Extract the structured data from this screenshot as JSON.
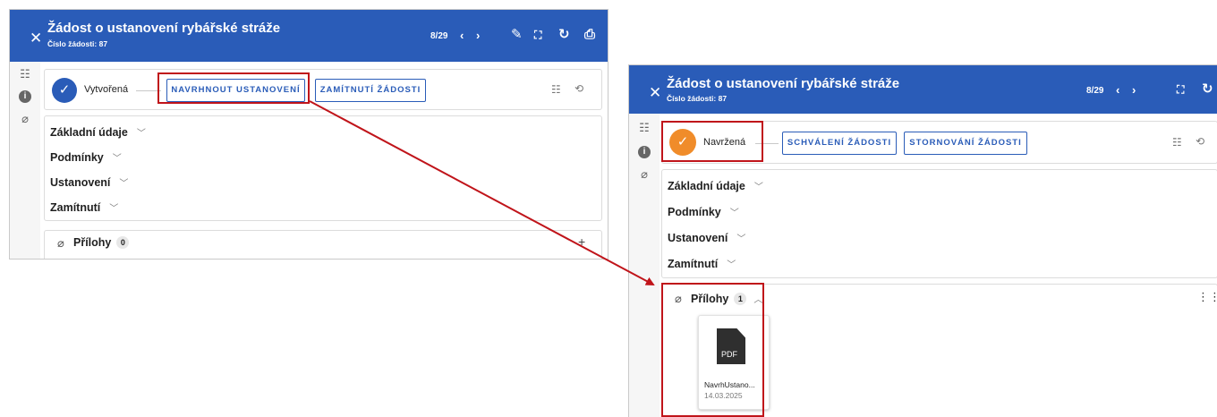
{
  "colors": {
    "header": "#2a5cb8",
    "accent": "#2a5cb8",
    "created": "#2a5cb8",
    "proposed": "#f08c2a",
    "highlight": "#c0141a"
  },
  "before": {
    "window_title": "Žádost o ustanovení rybářské stráže",
    "subtitle": "Číslo žádosti: 87",
    "pager": "8/29",
    "icons": [
      "close-icon",
      "prev-icon",
      "next-icon",
      "edit-icon",
      "fullscreen-icon",
      "refresh-icon",
      "print-icon"
    ],
    "status_label": "Vytvořená",
    "actions": [
      "NAVRHNOUT USTANOVENÍ",
      "ZAMÍTNUTÍ ŽÁDOSTI"
    ],
    "sections": [
      "Základní údaje",
      "Podmínky",
      "Ustanovení",
      "Zamítnutí"
    ],
    "attachments_label": "Přílohy",
    "attachments_count": "0"
  },
  "after": {
    "window_title": "Žádost o ustanovení rybářské stráže",
    "subtitle": "Číslo žádosti: 87",
    "pager": "8/29",
    "status_label": "Navržená",
    "actions": [
      "SCHVÁLENÍ ŽÁDOSTI",
      "STORNOVÁNÍ ŽÁDOSTI"
    ],
    "sections": [
      "Základní údaje",
      "Podmínky",
      "Ustanovení",
      "Zamítnutí"
    ],
    "attachments_label": "Přílohy",
    "attachments_count": "1",
    "file": {
      "type_label": "PDF",
      "name": "NavrhUstano...",
      "date": "14.03.2025"
    }
  }
}
